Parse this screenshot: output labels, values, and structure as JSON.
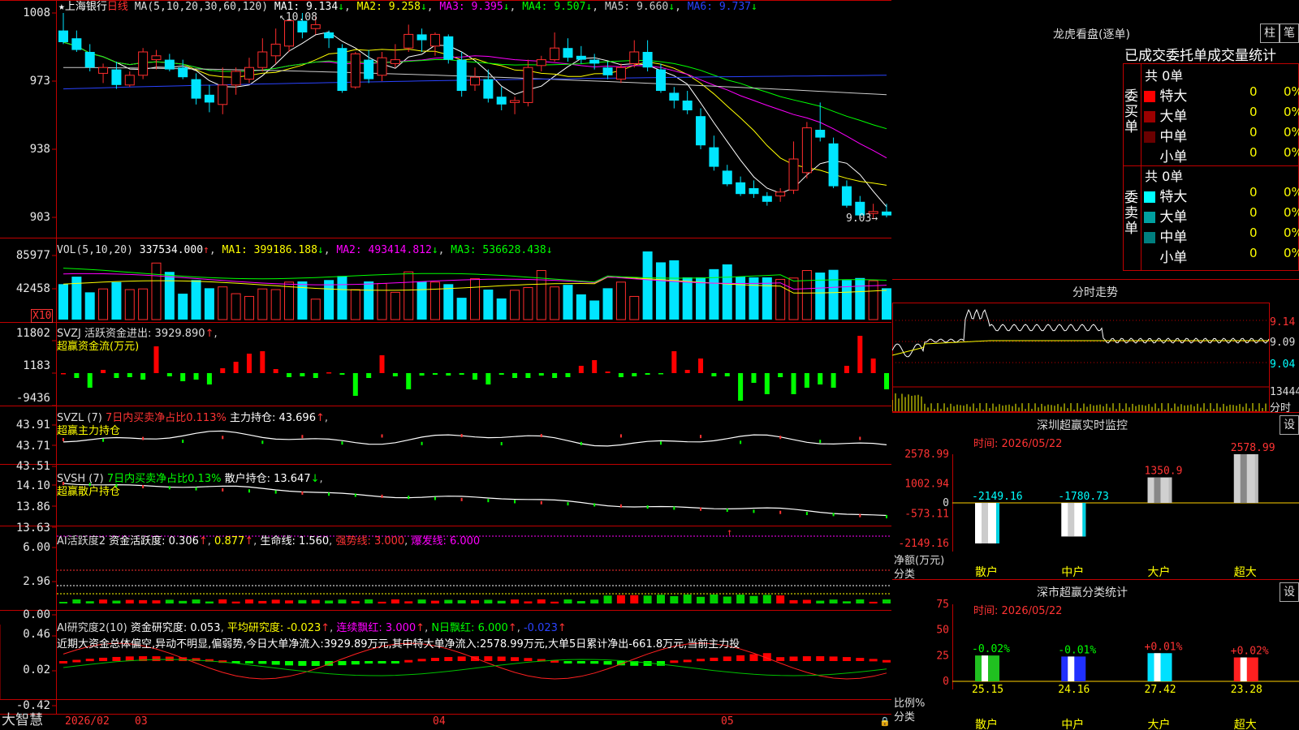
{
  "colors": {
    "up": "#ff2d2d",
    "down": "#00e5ff",
    "ma1": "#ffffff",
    "ma2": "#ffff00",
    "ma3": "#ff00ff",
    "ma4": "#00ff00",
    "ma5": "#cccccc",
    "ma6": "#2a43ff"
  },
  "kline": {
    "star": "★",
    "name": "上海银行",
    "period": "日线",
    "ma_params": "MA(5,10,20,30,60,120)",
    "ma1": "MA1: 9.134",
    "ma2": "MA2: 9.258",
    "ma3": "MA3: 9.395",
    "ma4": "MA4: 9.507",
    "ma5": "MA5: 9.660",
    "ma6": "MA6: 9.737",
    "high_label": "10.08",
    "low_label": "9.03",
    "yticks": [
      "1008",
      "973",
      "938",
      "903"
    ],
    "candles": [
      {
        "o": 9.99,
        "h": 10.08,
        "l": 9.92,
        "c": 9.93
      },
      {
        "o": 9.95,
        "h": 9.99,
        "l": 9.88,
        "c": 9.89
      },
      {
        "o": 9.88,
        "h": 9.92,
        "l": 9.78,
        "c": 9.8
      },
      {
        "o": 9.77,
        "h": 9.82,
        "l": 9.72,
        "c": 9.8
      },
      {
        "o": 9.79,
        "h": 9.83,
        "l": 9.69,
        "c": 9.71
      },
      {
        "o": 9.71,
        "h": 9.78,
        "l": 9.7,
        "c": 9.76
      },
      {
        "o": 9.76,
        "h": 9.9,
        "l": 9.74,
        "c": 9.88
      },
      {
        "o": 9.84,
        "h": 9.89,
        "l": 9.79,
        "c": 9.86
      },
      {
        "o": 9.84,
        "h": 9.87,
        "l": 9.78,
        "c": 9.79
      },
      {
        "o": 9.8,
        "h": 9.84,
        "l": 9.74,
        "c": 9.75
      },
      {
        "o": 9.74,
        "h": 9.77,
        "l": 9.61,
        "c": 9.64
      },
      {
        "o": 9.66,
        "h": 9.71,
        "l": 9.57,
        "c": 9.62
      },
      {
        "o": 9.61,
        "h": 9.8,
        "l": 9.56,
        "c": 9.71
      },
      {
        "o": 9.71,
        "h": 9.8,
        "l": 9.66,
        "c": 9.78
      },
      {
        "o": 9.74,
        "h": 9.85,
        "l": 9.72,
        "c": 9.8
      },
      {
        "o": 9.8,
        "h": 9.95,
        "l": 9.78,
        "c": 9.88
      },
      {
        "o": 9.86,
        "h": 10.0,
        "l": 9.82,
        "c": 9.92
      },
      {
        "o": 9.91,
        "h": 10.07,
        "l": 9.88,
        "c": 10.04
      },
      {
        "o": 10.04,
        "h": 10.08,
        "l": 9.95,
        "c": 9.98
      },
      {
        "o": 10.0,
        "h": 10.06,
        "l": 9.97,
        "c": 10.02
      },
      {
        "o": 9.98,
        "h": 9.99,
        "l": 9.9,
        "c": 9.95
      },
      {
        "o": 9.9,
        "h": 9.92,
        "l": 9.67,
        "c": 9.68
      },
      {
        "o": 9.7,
        "h": 9.88,
        "l": 9.69,
        "c": 9.87
      },
      {
        "o": 9.84,
        "h": 9.89,
        "l": 9.72,
        "c": 9.74
      },
      {
        "o": 9.76,
        "h": 9.88,
        "l": 9.73,
        "c": 9.85
      },
      {
        "o": 9.82,
        "h": 9.92,
        "l": 9.8,
        "c": 9.84
      },
      {
        "o": 9.9,
        "h": 10.02,
        "l": 9.88,
        "c": 9.97
      },
      {
        "o": 9.97,
        "h": 10.0,
        "l": 9.88,
        "c": 9.94
      },
      {
        "o": 9.91,
        "h": 9.98,
        "l": 9.86,
        "c": 9.97
      },
      {
        "o": 9.96,
        "h": 9.97,
        "l": 9.82,
        "c": 9.84
      },
      {
        "o": 9.84,
        "h": 9.88,
        "l": 9.65,
        "c": 9.68
      },
      {
        "o": 9.71,
        "h": 9.8,
        "l": 9.68,
        "c": 9.75
      },
      {
        "o": 9.74,
        "h": 9.79,
        "l": 9.62,
        "c": 9.64
      },
      {
        "o": 9.65,
        "h": 9.7,
        "l": 9.58,
        "c": 9.61
      },
      {
        "o": 9.62,
        "h": 9.65,
        "l": 9.56,
        "c": 9.63
      },
      {
        "o": 9.62,
        "h": 9.84,
        "l": 9.6,
        "c": 9.8
      },
      {
        "o": 9.81,
        "h": 9.86,
        "l": 9.78,
        "c": 9.84
      },
      {
        "o": 9.84,
        "h": 9.98,
        "l": 9.83,
        "c": 9.9
      },
      {
        "o": 9.9,
        "h": 9.95,
        "l": 9.83,
        "c": 9.85
      },
      {
        "o": 9.86,
        "h": 9.91,
        "l": 9.82,
        "c": 9.84
      },
      {
        "o": 9.84,
        "h": 9.87,
        "l": 9.79,
        "c": 9.82
      },
      {
        "o": 9.8,
        "h": 9.83,
        "l": 9.74,
        "c": 9.76
      },
      {
        "o": 9.74,
        "h": 9.82,
        "l": 9.72,
        "c": 9.8
      },
      {
        "o": 9.82,
        "h": 9.94,
        "l": 9.8,
        "c": 9.88
      },
      {
        "o": 9.88,
        "h": 9.94,
        "l": 9.78,
        "c": 9.8
      },
      {
        "o": 9.79,
        "h": 9.82,
        "l": 9.67,
        "c": 9.68
      },
      {
        "o": 9.67,
        "h": 9.7,
        "l": 9.59,
        "c": 9.63
      },
      {
        "o": 9.63,
        "h": 9.68,
        "l": 9.56,
        "c": 9.58
      },
      {
        "o": 9.55,
        "h": 9.59,
        "l": 9.38,
        "c": 9.4
      },
      {
        "o": 9.39,
        "h": 9.45,
        "l": 9.27,
        "c": 9.29
      },
      {
        "o": 9.27,
        "h": 9.3,
        "l": 9.19,
        "c": 9.2
      },
      {
        "o": 9.21,
        "h": 9.24,
        "l": 9.14,
        "c": 9.15
      },
      {
        "o": 9.18,
        "h": 9.22,
        "l": 9.13,
        "c": 9.15
      },
      {
        "o": 9.14,
        "h": 9.16,
        "l": 9.09,
        "c": 9.11
      },
      {
        "o": 9.14,
        "h": 9.18,
        "l": 9.11,
        "c": 9.16
      },
      {
        "o": 9.17,
        "h": 9.42,
        "l": 9.15,
        "c": 9.33
      },
      {
        "o": 9.26,
        "h": 9.52,
        "l": 9.23,
        "c": 9.49
      },
      {
        "o": 9.48,
        "h": 9.62,
        "l": 9.42,
        "c": 9.44
      },
      {
        "o": 9.41,
        "h": 9.44,
        "l": 9.18,
        "c": 9.19
      },
      {
        "o": 9.19,
        "h": 9.22,
        "l": 9.08,
        "c": 9.09
      },
      {
        "o": 9.11,
        "h": 9.14,
        "l": 9.02,
        "c": 9.04
      },
      {
        "o": 9.05,
        "h": 9.1,
        "l": 9.02,
        "c": 9.06
      },
      {
        "o": 9.06,
        "h": 9.1,
        "l": 9.03,
        "c": 9.04
      }
    ]
  },
  "vol": {
    "label": "VOL(5,10,20)",
    "value": "337534.000",
    "ma1": "MA1: 399186.188",
    "ma2": "MA2: 493414.812",
    "ma3": "MA3: 536628.438",
    "yticks": [
      "85977",
      "42458"
    ],
    "unit": "X10"
  },
  "svzj": {
    "label": "SVZJ  活跃资金进出:",
    "value": "3929.890",
    "sub": "超赢资金流(万元)",
    "yticks": [
      "11802",
      "1183",
      "-9436"
    ]
  },
  "svzl": {
    "label": "SVZL (7)",
    "desc": "7日内买卖净占比0.113%",
    "hold": "主力持仓: 43.696",
    "sub": "超赢主力持仓",
    "yticks": [
      "43.91",
      "43.71",
      "43.51"
    ]
  },
  "svsh": {
    "label": "SVSH (7)",
    "desc": "7日内买卖净占比0.13%",
    "hold": "散户持仓: 13.647",
    "sub": "超赢散户持仓",
    "yticks": [
      "14.10",
      "13.86",
      "13.63"
    ]
  },
  "ai1": {
    "label": "AI活跃度2",
    "a": "资金活跃度: 0.306",
    "b": "0.877",
    "c": "生命线: 1.560",
    "d": "强势线: 3.000",
    "e": "爆发线: 6.000",
    "yticks": [
      "6.00",
      "2.96",
      "0.00"
    ]
  },
  "ai2": {
    "label": "AI研究度2(10)",
    "a": "资金研究度: 0.053",
    "b": "平均研究度: -0.023",
    "c": "连续飘红: 3.000",
    "d": "N日飘红: 6.000",
    "e": "-0.023",
    "text": "近期大资金总体偏空,异动不明显,偏弱势,今日大单净流入:3929.89万元,其中特大单净流入:2578.99万元,大单5日累计净出-661.8万元,当前主力投",
    "yticks": [
      "0.46",
      "0.02",
      "-0.42"
    ]
  },
  "xaxis": {
    "labels": [
      "2026/02",
      "03",
      "04",
      "05"
    ],
    "brand": "大智慧"
  },
  "lhb": {
    "title": "龙虎看盘(逐单)",
    "btn1": "柱",
    "btn2": "笔",
    "tabs": "已成交委托单成交量统计",
    "buy": {
      "side": "委买单",
      "total": "共 0单",
      "rows": [
        {
          "name": "特大",
          "n": "0",
          "p": "0%",
          "color": "#ff0000"
        },
        {
          "name": "大单",
          "n": "0",
          "p": "0%",
          "color": "#9b0000"
        },
        {
          "name": "中单",
          "n": "0",
          "p": "0%",
          "color": "#6a0000"
        },
        {
          "name": "小单",
          "n": "0",
          "p": "0%",
          "color": ""
        }
      ]
    },
    "sell": {
      "side": "委卖单",
      "total": "共 0单",
      "rows": [
        {
          "name": "特大",
          "n": "0",
          "p": "0%",
          "color": "#00ffff"
        },
        {
          "name": "大单",
          "n": "0",
          "p": "0%",
          "color": "#00a0a0"
        },
        {
          "name": "中单",
          "n": "0",
          "p": "0%",
          "color": "#007f7f"
        },
        {
          "name": "小单",
          "n": "0",
          "p": "0%",
          "color": ""
        }
      ]
    }
  },
  "fenshi": {
    "title": "分时走势",
    "yticks": [
      "9.14",
      "9.09",
      "9.04"
    ],
    "vol": "13444",
    "unit": "分时"
  },
  "sz": {
    "title": "深圳超赢实时监控",
    "btn": "设",
    "date": "时间: 2026/05/22",
    "yticks": [
      "2578.99",
      "1002.94",
      "0",
      "-573.11",
      "-2149.16"
    ],
    "ylabel": "净额(万元)",
    "xname": "分类",
    "cats": [
      "散户",
      "中户",
      "大户",
      "超大"
    ],
    "values": [
      -2149.16,
      -1780.73,
      1350.9,
      2578.99
    ],
    "vlabels": [
      "-2149.16",
      "-1780.73",
      "1350.9",
      "2578.99"
    ]
  },
  "szfl": {
    "title": "深市超赢分类统计",
    "btn": "设",
    "date": "时间: 2026/05/22",
    "yticks": [
      "75",
      "50",
      "25",
      "0"
    ],
    "ylabel": "比例%",
    "xname": "分类",
    "cats": [
      "散户",
      "中户",
      "大户",
      "超大"
    ],
    "values": [
      25.15,
      24.16,
      27.42,
      23.28
    ],
    "deltas": [
      "-0.02%",
      "-0.01%",
      "+0.01%",
      "+0.02%"
    ],
    "bar_colors": [
      "#20c020",
      "#2030ff",
      "#00e0ff",
      "#ff2020"
    ]
  }
}
